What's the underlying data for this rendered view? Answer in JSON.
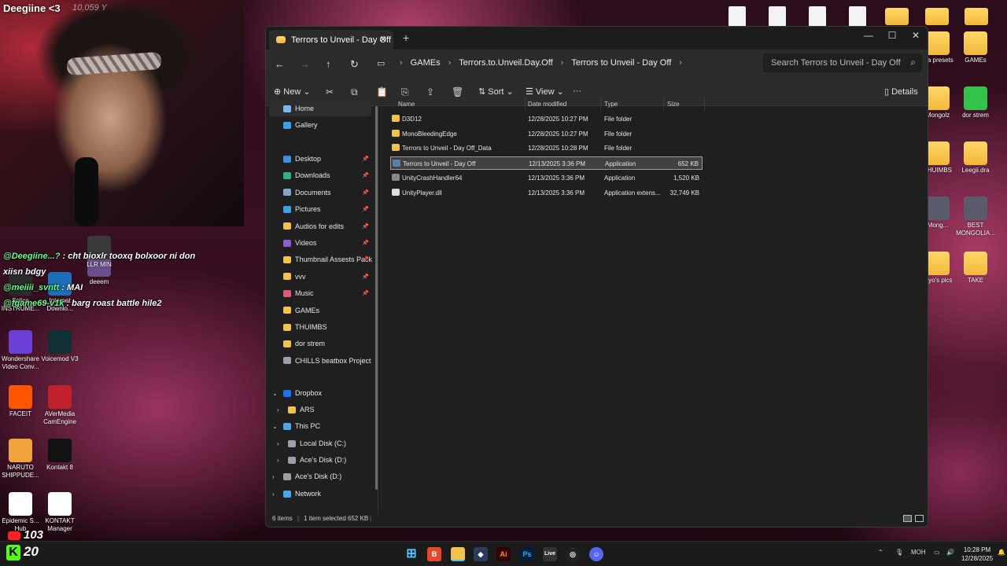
{
  "stream": {
    "name": "Deegiine <3",
    "count": "10,059 Y"
  },
  "chat": [
    {
      "user": "@Deegiine...?",
      "text": " : cht bioxlr tooxq bolxoor ni don"
    },
    {
      "user": "",
      "text": "xiisn bdgy"
    },
    {
      "user": "@meiiii_svntt",
      "text": " : MAI"
    },
    {
      "user": "@fgame69-v1k",
      "text": " : barg roast battle hile2"
    }
  ],
  "desktop_left": [
    {
      "label": "Splice INSTRUME...",
      "name": "splice"
    },
    {
      "label": "Internet Downlo...",
      "name": "internet-download"
    },
    {
      "label": "deeem",
      "name": "deeem"
    },
    {
      "label": "LLR MIN",
      "name": "llr-min"
    },
    {
      "label": "Wondershare Video Conv...",
      "name": "wondershare"
    },
    {
      "label": "Voicemod V3",
      "name": "voicemod"
    },
    {
      "label": "FACEIT",
      "name": "faceit"
    },
    {
      "label": "AVerMedia CamEngine",
      "name": "avermedia"
    },
    {
      "label": "NARUTO SHIPPUDE...",
      "name": "naruto"
    },
    {
      "label": "Kontakt 8",
      "name": "kontakt8"
    },
    {
      "label": "Epidemic S... Hub",
      "name": "epidemic"
    },
    {
      "label": "KONTAKT Manager",
      "name": "kontakt-manager"
    }
  ],
  "desktop_right": [
    {
      "label": "...a presets",
      "name": "presets"
    },
    {
      "label": "GAMEs",
      "name": "games"
    },
    {
      "label": "Mongolz",
      "name": "mongolz"
    },
    {
      "label": "dor strem",
      "name": "dor-strem"
    },
    {
      "label": "THUIMBS",
      "name": "thuimbs"
    },
    {
      "label": "Leegii.dra",
      "name": "leegii"
    },
    {
      "label": "Mong...",
      "name": "mong"
    },
    {
      "label": "BEST MONGOLIA...",
      "name": "best-mongolia"
    },
    {
      "label": "...yo's pics",
      "name": "yos-pics"
    },
    {
      "label": "TAKE",
      "name": "take"
    }
  ],
  "window": {
    "tab_title": "Terrors to Unveil - Day Off",
    "new_tab": "+",
    "breadcrumbs": [
      "GAMEs",
      "Terrors.to.Unveil.Day.Off",
      "Terrors to Unveil - Day Off"
    ],
    "search_placeholder": "Search Terrors to Unveil - Day Off",
    "toolbar": {
      "new": "New",
      "sort": "Sort",
      "view": "View",
      "more": "···",
      "details": "Details"
    }
  },
  "nav": {
    "home": "Home",
    "gallery": "Gallery",
    "quick": [
      {
        "label": "Desktop",
        "color": "#3d8fe0"
      },
      {
        "label": "Downloads",
        "color": "#2fb08a"
      },
      {
        "label": "Documents",
        "color": "#8aa4c8"
      },
      {
        "label": "Pictures",
        "color": "#3aa0e8"
      },
      {
        "label": "Audios for edits",
        "color": "#f2c14e"
      },
      {
        "label": "Videos",
        "color": "#8a5cd6"
      },
      {
        "label": "Thumbnail Assests Pack",
        "color": "#f2c14e"
      },
      {
        "label": "vvv",
        "color": "#f2c14e"
      },
      {
        "label": "Music",
        "color": "#e05a7a"
      },
      {
        "label": "GAMEs",
        "color": "#f2c14e"
      },
      {
        "label": "THUIMBS",
        "color": "#f2c14e"
      },
      {
        "label": "dor strem",
        "color": "#f2c14e"
      },
      {
        "label": "CHILLS beatbox Project",
        "color": "#9aa0a6"
      }
    ],
    "dropbox": "Dropbox",
    "ars": "ARS",
    "this_pc": "This PC",
    "local_disk": "Local Disk (C:)",
    "aces_disk_sub": "Ace's Disk (D:)",
    "aces_disk": "Ace's Disk (D:)",
    "network": "Network"
  },
  "columns": {
    "name": "Name",
    "date": "Date modified",
    "type": "Type",
    "size": "Size"
  },
  "files": [
    {
      "name": "D3D12",
      "date": "12/28/2025 10:27 PM",
      "type": "File folder",
      "size": "",
      "kind": "folder"
    },
    {
      "name": "MonoBleedingEdge",
      "date": "12/28/2025 10:27 PM",
      "type": "File folder",
      "size": "",
      "kind": "folder"
    },
    {
      "name": "Terrors to Unveil - Day Off_Data",
      "date": "12/28/2025 10:28 PM",
      "type": "File folder",
      "size": "",
      "kind": "folder"
    },
    {
      "name": "Terrors to Unveil - Day Off",
      "date": "12/13/2025 3:36 PM",
      "type": "Application",
      "size": "652 KB",
      "kind": "app"
    },
    {
      "name": "UnityCrashHandler64",
      "date": "12/13/2025 3:36 PM",
      "type": "Application",
      "size": "1,520 KB",
      "kind": "app2"
    },
    {
      "name": "UnityPlayer.dll",
      "date": "12/13/2025 3:36 PM",
      "type": "Application extens...",
      "size": "32,749 KB",
      "kind": "dll"
    }
  ],
  "status": {
    "items": "6 items",
    "selected": "1 item selected",
    "size": "652 KB"
  },
  "taskbar": {
    "kick_count": "20",
    "yt_count": "103",
    "lang": "MOH",
    "time": "10:28 PM",
    "date": "12/28/2025"
  },
  "colors": {
    "folder": "#f2c14e",
    "accent": "#3d8fe0",
    "kick": "#53fc18"
  }
}
